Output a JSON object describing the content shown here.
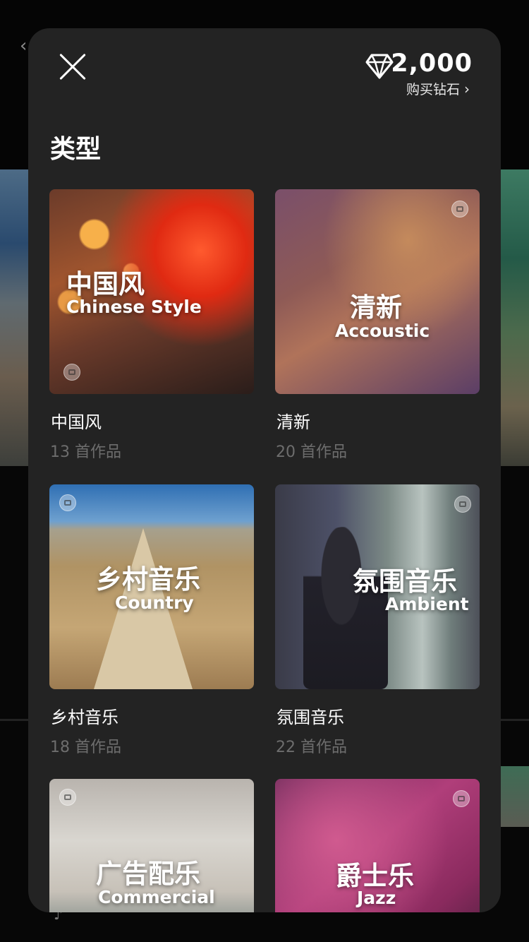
{
  "balance": {
    "amount": "2,000",
    "buy_label": "购买钻石"
  },
  "section": {
    "title": "类型"
  },
  "genres": [
    {
      "cover_cn": "中国风",
      "cover_en": "Chinese Style",
      "title": "中国风",
      "count": "13 首作品"
    },
    {
      "cover_cn": "清新",
      "cover_en": "Accoustic",
      "title": "清新",
      "count": "20 首作品"
    },
    {
      "cover_cn": "乡村音乐",
      "cover_en": "Country",
      "title": "乡村音乐",
      "count": "18 首作品"
    },
    {
      "cover_cn": "氛围音乐",
      "cover_en": "Ambient",
      "title": "氛围音乐",
      "count": "22 首作品"
    },
    {
      "cover_cn": "广告配乐",
      "cover_en": "Commercial"
    },
    {
      "cover_cn": "爵士乐",
      "cover_en": "Jazz"
    }
  ],
  "icons": {
    "close": "close-icon",
    "diamond": "diamond-icon",
    "chevron": "chevron-right-icon",
    "camera": "camera-icon"
  },
  "colors": {
    "modal_bg": "#232323",
    "page_bg": "#060606",
    "count_text": "#6d6d6d"
  }
}
